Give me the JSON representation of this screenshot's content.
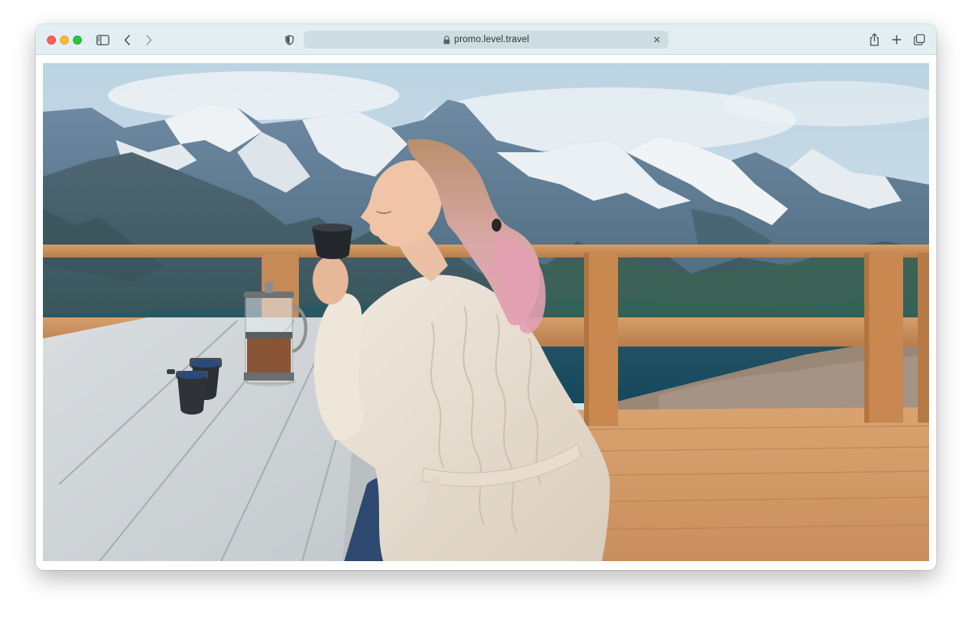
{
  "browser": {
    "address_bar": {
      "url_display": "promo.level.travel"
    },
    "icons": {
      "sidebar": "sidebar-icon",
      "back": "chevron-left-icon",
      "forward": "chevron-right-icon",
      "privacy": "shield-icon",
      "lock": "lock-icon",
      "clear": "close-icon",
      "share": "share-icon",
      "new_tab": "plus-icon",
      "tab_overview": "tab-overview-icon"
    },
    "colors": {
      "toolbar": "#e2eef2",
      "address_bar": "#cfdde2",
      "close": "#ff5f57",
      "minimize": "#febc2e",
      "zoom": "#28c840"
    }
  },
  "content": {
    "image": {
      "subject": "woman-with-cup-on-mountain-terrace"
    }
  }
}
